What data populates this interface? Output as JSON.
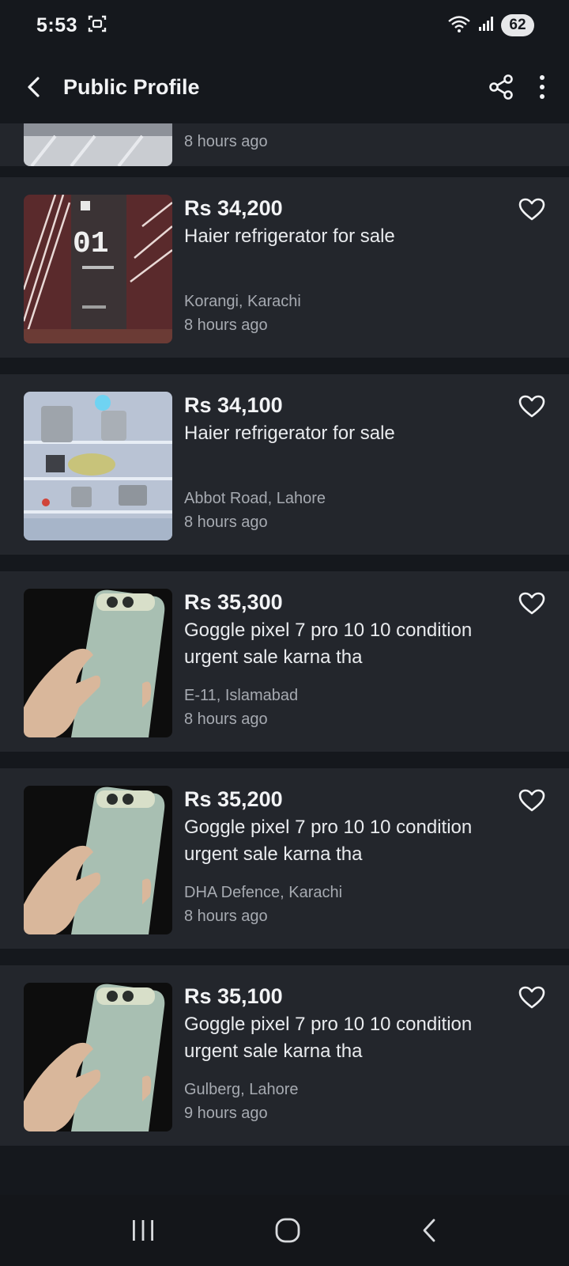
{
  "status_bar": {
    "time": "5:53",
    "battery": "62"
  },
  "app_bar": {
    "title": "Public Profile"
  },
  "partial_item": {
    "time_ago": "8 hours ago"
  },
  "listings": [
    {
      "price": "Rs 34,200",
      "title": "Haier refrigerator for sale",
      "location": "Korangi, Karachi",
      "time_ago": "8 hours ago"
    },
    {
      "price": "Rs 34,100",
      "title": "Haier refrigerator for sale",
      "location": "Abbot Road, Lahore",
      "time_ago": "8 hours ago"
    },
    {
      "price": "Rs 35,300",
      "title": "Goggle pixel 7 pro 10 10 condition urgent sale karna tha",
      "location": "E-11, Islamabad",
      "time_ago": "8 hours ago"
    },
    {
      "price": "Rs 35,200",
      "title": "Goggle pixel 7 pro 10 10 condition urgent sale karna tha",
      "location": "DHA Defence, Karachi",
      "time_ago": "8 hours ago"
    },
    {
      "price": "Rs 35,100",
      "title": "Goggle pixel 7 pro 10 10 condition urgent sale karna tha",
      "location": "Gulberg, Lahore",
      "time_ago": "9 hours ago"
    }
  ],
  "icons": {
    "back": "back-arrow-icon",
    "share": "share-icon",
    "more": "more-vertical-icon",
    "favorite": "heart-outline-icon",
    "nav_recents": "recents-icon",
    "nav_home": "home-icon",
    "nav_back": "nav-back-icon"
  },
  "colors": {
    "background": "#15181d",
    "card": "#23262c",
    "text": "#e9ebee",
    "muted": "#a6aab1"
  }
}
